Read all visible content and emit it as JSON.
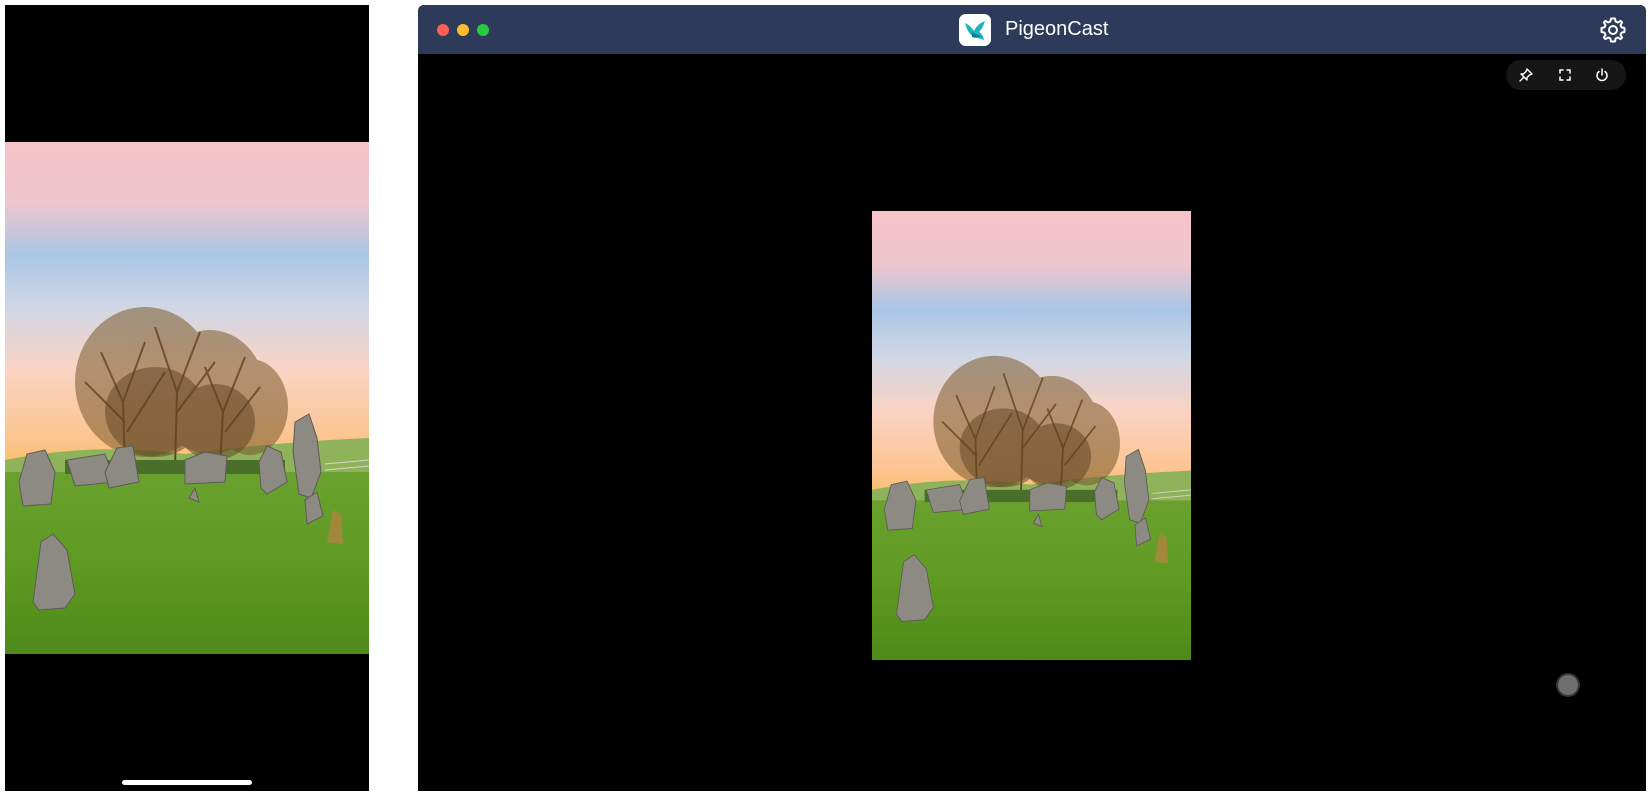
{
  "app": {
    "title": "PigeonCast"
  },
  "titlebar": {
    "logo_icon": "pigeon-logo-icon",
    "settings_icon": "gear-icon"
  },
  "toolbar": {
    "items": [
      {
        "name": "pin",
        "icon": "pin-icon"
      },
      {
        "name": "fullscreen",
        "icon": "fullscreen-icon"
      },
      {
        "name": "power",
        "icon": "power-icon"
      }
    ]
  },
  "colors": {
    "titlebar": "#2d3a5a",
    "close": "#fe5f57",
    "minimize": "#febc2e",
    "maximize": "#28c840",
    "logo_teal": "#19b3c2"
  }
}
